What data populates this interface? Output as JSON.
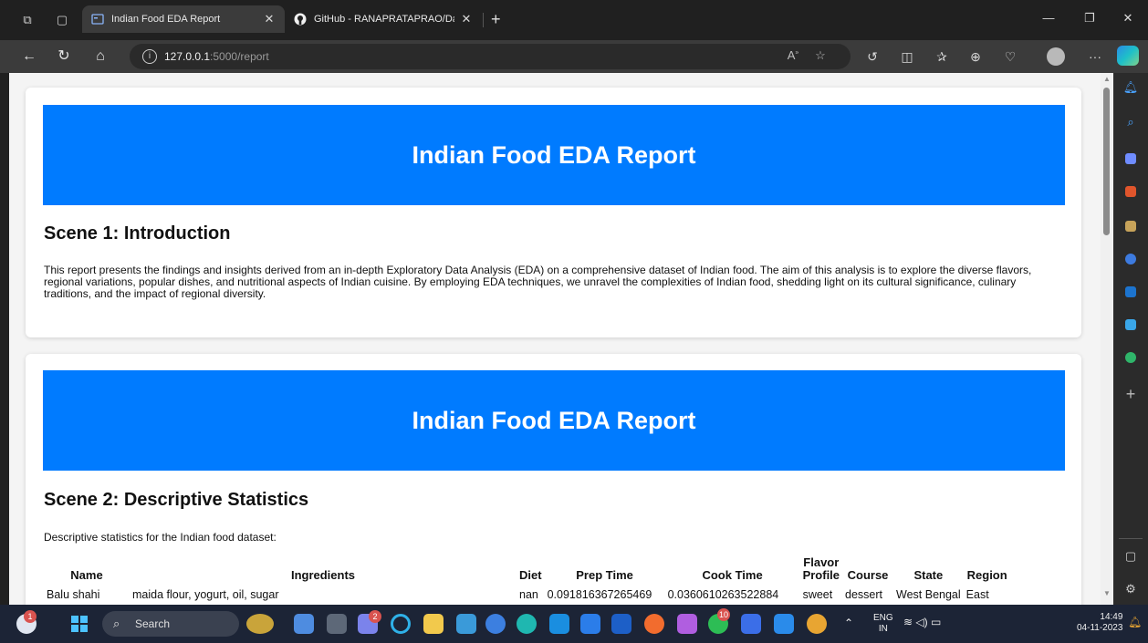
{
  "browser": {
    "tabs": [
      {
        "title": "Indian Food EDA Report",
        "active": true
      },
      {
        "title": "GitHub - RANAPRATAPRAO/Data",
        "active": false
      }
    ],
    "address": {
      "host": "127.0.0.1",
      "path": ":5000/report"
    }
  },
  "page": {
    "scene1": {
      "banner": "Indian Food EDA Report",
      "title": "Scene 1: Introduction",
      "text": "This report presents the findings and insights derived from an in-depth Exploratory Data Analysis (EDA) on a comprehensive dataset of Indian food. The aim of this analysis is to explore the diverse flavors, regional variations, popular dishes, and nutritional aspects of Indian cuisine. By employing EDA techniques, we unravel the complexities of Indian food, shedding light on its cultural significance, culinary traditions, and the impact of regional diversity."
    },
    "scene2": {
      "banner": "Indian Food EDA Report",
      "title": "Scene 2: Descriptive Statistics",
      "text": "Descriptive statistics for the Indian food dataset:",
      "columns": [
        "Name",
        "Ingredients",
        "Diet",
        "Prep Time",
        "Cook Time",
        "Flavor Profile",
        "Course",
        "State",
        "Region"
      ],
      "rows": [
        [
          "Balu shahi",
          "maida flour, yogurt, oil, sugar",
          "nan",
          "0.091816367265469",
          "0.0360610263522884",
          "sweet",
          "dessert",
          "West Bengal",
          "East"
        ]
      ]
    }
  },
  "taskbar": {
    "search_label": "Search",
    "lang": "ENG",
    "lang_sub": "IN",
    "time": "14:49",
    "date": "04-11-2023",
    "badges": {
      "weather": "1",
      "chat": "2",
      "whatsapp": "10"
    }
  }
}
